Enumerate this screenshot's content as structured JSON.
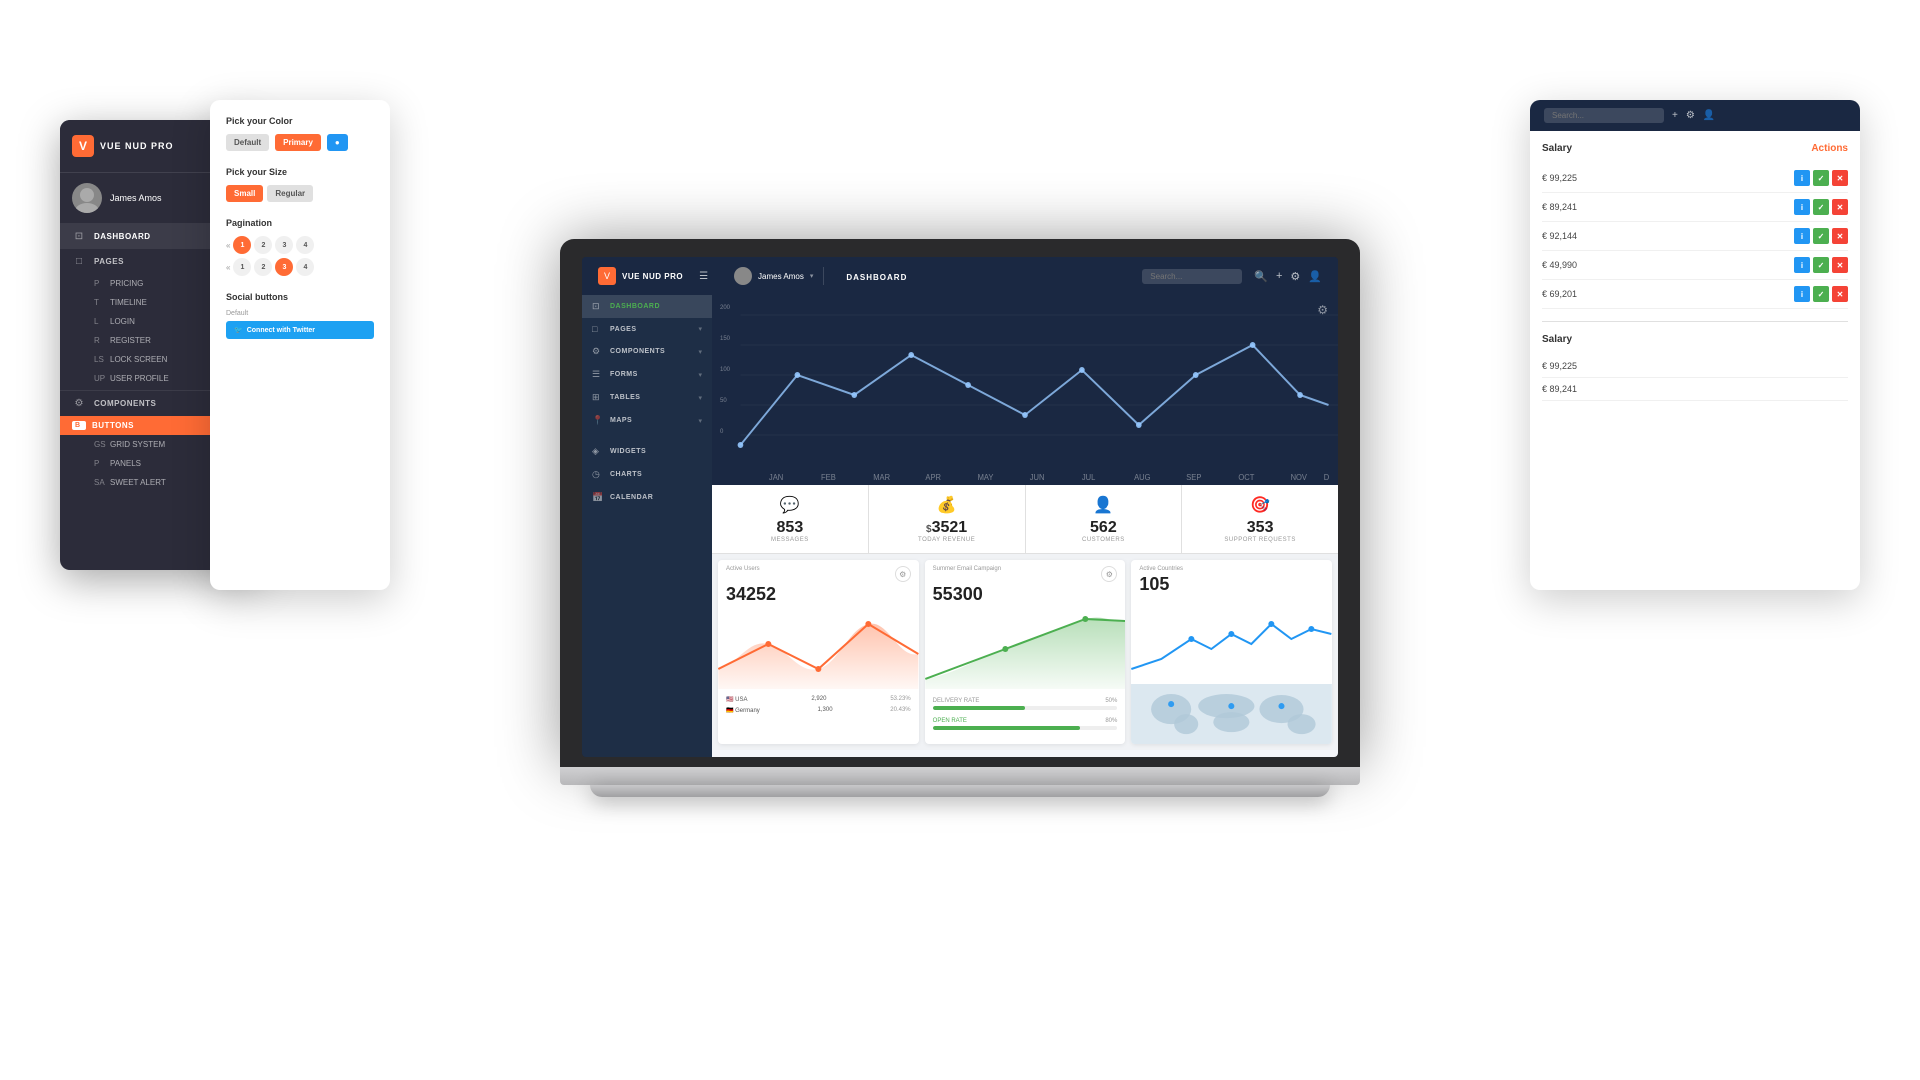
{
  "brand": {
    "name": "VUE NUD PRO",
    "icon": "V"
  },
  "user": {
    "name": "James Amos"
  },
  "left_sidebar": {
    "nav_items": [
      {
        "id": "dashboard",
        "label": "DASHBOARD",
        "icon": "⊡",
        "active": true
      },
      {
        "id": "pages",
        "label": "PAGES",
        "icon": "📄",
        "has_arrow": true,
        "active": false
      },
      {
        "id": "components",
        "label": "COMPONENTS",
        "icon": "⚙",
        "has_arrow": true,
        "active": true,
        "sub_items": [
          {
            "prefix": "P",
            "label": "PRICING"
          },
          {
            "prefix": "T",
            "label": "TIMELINE"
          },
          {
            "prefix": "L",
            "label": "LOGIN"
          },
          {
            "prefix": "R",
            "label": "REGISTER"
          },
          {
            "prefix": "LS",
            "label": "LOCK SCREEN"
          },
          {
            "prefix": "UP",
            "label": "USER PROFILE"
          }
        ]
      },
      {
        "id": "buttons",
        "label": "BUTTONS",
        "icon": "B",
        "active": true,
        "highlight": true
      }
    ],
    "more_items": [
      {
        "prefix": "GS",
        "label": "GRID SYSTEM"
      },
      {
        "prefix": "P",
        "label": "PANELS"
      },
      {
        "prefix": "SA",
        "label": "SWEET ALERT"
      }
    ]
  },
  "color_picker": {
    "title": "Pick your Color",
    "buttons": [
      "Default",
      "Primary"
    ],
    "size_title": "Pick your Size",
    "sizes": [
      "Small",
      "Regular"
    ],
    "pagination_title": "Pagination",
    "pagination_rows": [
      [
        {
          "label": "«"
        },
        {
          "label": "1",
          "active": true
        },
        {
          "label": "2"
        },
        {
          "label": "3"
        },
        {
          "label": "4"
        }
      ],
      [
        {
          "label": "«"
        },
        {
          "label": "1"
        },
        {
          "label": "2"
        },
        {
          "label": "3",
          "active": true
        },
        {
          "label": "4"
        }
      ]
    ],
    "social_title": "Social buttons",
    "default_label": "Default",
    "twitter_btn": "Connect with Twitter"
  },
  "dashboard": {
    "header": {
      "title": "DASHBOARD",
      "search_placeholder": "Search...",
      "user_name": "James Amos"
    },
    "sidebar": {
      "items": [
        {
          "label": "DASHBOARD",
          "icon": "⊡",
          "active": true
        },
        {
          "label": "PAGES",
          "icon": "📄",
          "has_arrow": true
        },
        {
          "label": "COMPONENTS",
          "icon": "⚙",
          "has_arrow": true
        },
        {
          "label": "FORMS",
          "icon": "☰",
          "has_arrow": true
        },
        {
          "label": "TABLES",
          "icon": "⊞",
          "has_arrow": true
        },
        {
          "label": "MAPS",
          "icon": "📍",
          "has_arrow": true
        },
        {
          "label": "WIDGETS",
          "icon": "◈"
        },
        {
          "label": "CHARTS",
          "icon": "◷"
        },
        {
          "label": "CALENDAR",
          "icon": "📅"
        }
      ]
    },
    "chart": {
      "y_labels": [
        "200",
        "150",
        "100",
        "50",
        "0"
      ],
      "x_labels": [
        "JAN",
        "FEB",
        "MAR",
        "APR",
        "MAY",
        "JUN",
        "JUL",
        "AUG",
        "SEP",
        "OCT",
        "NOV",
        "D"
      ]
    },
    "stats": [
      {
        "id": "messages",
        "icon": "💬",
        "icon_color": "#e91e63",
        "value": "853",
        "label": "MESSAGES"
      },
      {
        "id": "revenue",
        "icon": "💰",
        "icon_color": "#4caf50",
        "prefix": "$",
        "value": "3521",
        "label": "TODAY REVENUE"
      },
      {
        "id": "customers",
        "icon": "👤",
        "icon_color": "#2196f3",
        "value": "562",
        "label": "CUSTOMERS"
      },
      {
        "id": "support",
        "icon": "🎯",
        "icon_color": "#f44336",
        "value": "353",
        "label": "SUPPORT REQUESTS"
      }
    ],
    "mini_charts": [
      {
        "id": "active-users",
        "title": "Active Users",
        "value": "34252",
        "color": "#ff6b35",
        "countries": [
          {
            "flag": "🇺🇸",
            "name": "USA",
            "value": "2,920",
            "pct": "53.23%"
          },
          {
            "flag": "🇩🇪",
            "name": "Germany",
            "value": "1,300",
            "pct": "20.43%"
          }
        ]
      },
      {
        "id": "email-campaign",
        "title": "Summer Email Campaign",
        "value": "55300",
        "color": "#4caf50",
        "delivery_rate": "50%",
        "open_rate": "80%"
      },
      {
        "id": "active-countries",
        "title": "Active Countries",
        "value": "105",
        "color": "#2196f3"
      }
    ]
  },
  "right_table": {
    "salary_label": "Salary",
    "actions_label": "Actions",
    "rows": [
      {
        "value": "€ 99,225"
      },
      {
        "value": "€ 89,241"
      },
      {
        "value": "€ 92,144"
      },
      {
        "value": "€ 49,990"
      },
      {
        "value": "€ 69,201"
      }
    ],
    "rows2": [
      {
        "value": "€ 99,225"
      },
      {
        "value": "€ 89,241"
      }
    ]
  }
}
